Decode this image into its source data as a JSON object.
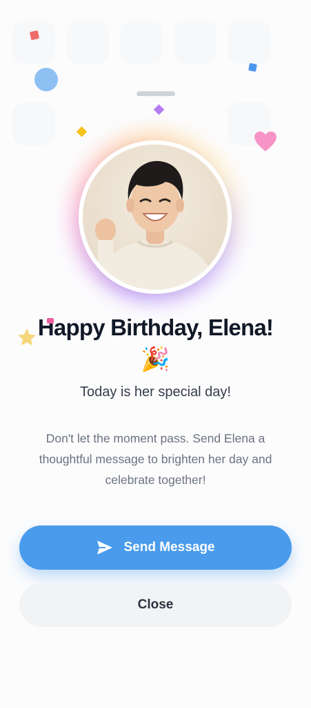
{
  "dialog": {
    "title": "Happy Birthday, Elena!",
    "title_emoji": "🎉",
    "subtitle": "Today is her special day!",
    "message": "Don't let the moment pass. Send Elena a thoughtful message to brighten her day and celebrate together!"
  },
  "actions": {
    "primary_label": "Send Message",
    "primary_icon": "send-icon",
    "secondary_label": "Close"
  },
  "colors": {
    "primary": "#4a9beb",
    "secondary_bg": "#f2f3f5",
    "title_text": "#111827",
    "body_text": "#6b7280"
  },
  "decorations": {
    "icons": [
      "heart-icon",
      "star-icon",
      "confetti"
    ]
  }
}
